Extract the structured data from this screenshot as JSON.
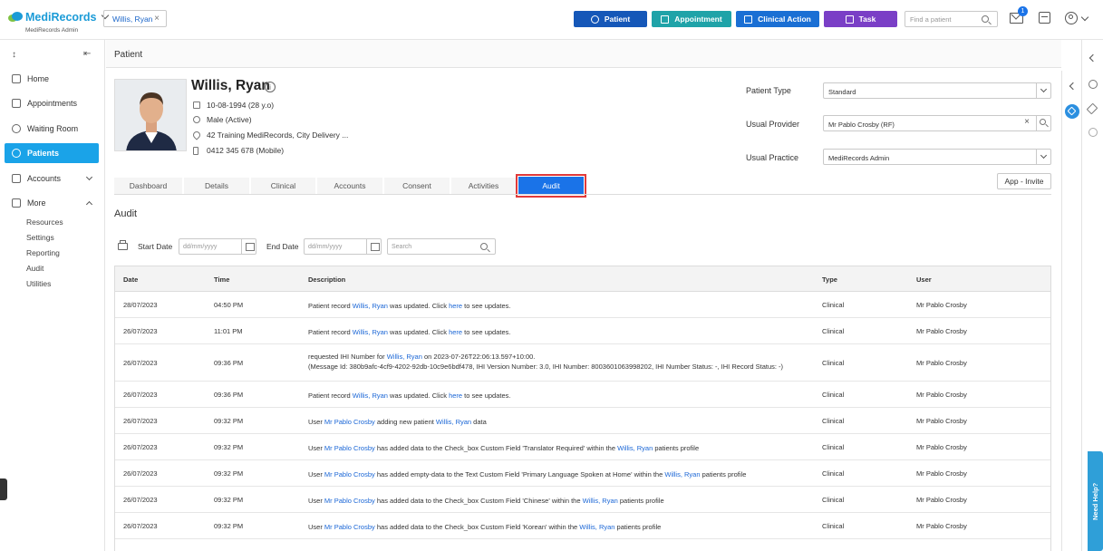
{
  "header": {
    "brand": "MediRecords",
    "brand_sub": "MediRecords Admin",
    "patient_chip": "Willis, Ryan",
    "buttons": [
      {
        "label": "Patient",
        "color": "#1557b8"
      },
      {
        "label": "Appointment",
        "color": "#1fa3a8"
      },
      {
        "label": "Clinical Action",
        "color": "#1a6fd4"
      },
      {
        "label": "Task",
        "color": "#7a3fc6"
      }
    ],
    "find_placeholder": "Find a patient",
    "notification_count": "1"
  },
  "sidebar": {
    "items": [
      {
        "label": "Home"
      },
      {
        "label": "Appointments"
      },
      {
        "label": "Waiting Room"
      },
      {
        "label": "Patients"
      },
      {
        "label": "Accounts"
      },
      {
        "label": "More"
      }
    ],
    "sub_items": [
      "Resources",
      "Settings",
      "Reporting",
      "Audit",
      "Utilities"
    ]
  },
  "page": {
    "title": "Patient",
    "patient": {
      "name": "Willis, Ryan",
      "dob": "10-08-1994 (28 y.o)",
      "gender": "Male (Active)",
      "address": "42 Training MediRecords, City Delivery ...",
      "phone": "0412 345 678 (Mobile)"
    },
    "fields": {
      "patient_type_label": "Patient Type",
      "patient_type_value": "Standard",
      "provider_label": "Usual Provider",
      "provider_value": "Mr Pablo Crosby (RF)",
      "practice_label": "Usual Practice",
      "practice_value": "MediRecords Admin"
    },
    "app_invite": "App - Invite",
    "tabs": [
      "Dashboard",
      "Details",
      "Clinical",
      "Accounts",
      "Consent",
      "Activities",
      "Audit"
    ]
  },
  "audit": {
    "title": "Audit",
    "start_label": "Start Date",
    "end_label": "End Date",
    "date_placeholder": "dd/mm/yyyy",
    "search_placeholder": "Search",
    "columns": [
      "Date",
      "Time",
      "Description",
      "Type",
      "User"
    ],
    "rows": [
      {
        "date": "28/07/2023",
        "time": "04:50 PM",
        "pre": "Patient record ",
        "link1": "Willis, Ryan",
        "mid": " was updated. Click ",
        "link2": "here",
        "post": " to see updates.",
        "type": "Clinical",
        "user": "Mr Pablo Crosby"
      },
      {
        "date": "26/07/2023",
        "time": "11:01 PM",
        "pre": "Patient record ",
        "link1": "Willis, Ryan",
        "mid": " was updated. Click ",
        "link2": "here",
        "post": " to see updates.",
        "type": "Clinical",
        "user": "Mr Pablo Crosby"
      },
      {
        "date": "26/07/2023",
        "time": "09:36 PM",
        "pre": "requested IHI Number for ",
        "link1": "Willis, Ryan",
        "mid": " on 2023-07-26T22:06:13.597+10:00.",
        "line2": "(Message Id: 380b9afc-4cf9-4202-92db-10c9e6bdf478, IHI Version Number: 3.0, IHI Number: 8003601063998202, IHI Number Status: -, IHI Record Status: -)",
        "type": "Clinical",
        "user": "Mr Pablo Crosby"
      },
      {
        "date": "26/07/2023",
        "time": "09:36 PM",
        "pre": "Patient record ",
        "link1": "Willis, Ryan",
        "mid": " was updated. Click ",
        "link2": "here",
        "post": " to see updates.",
        "type": "Clinical",
        "user": "Mr Pablo Crosby"
      },
      {
        "date": "26/07/2023",
        "time": "09:32 PM",
        "pre": "User ",
        "link1": "Mr Pablo Crosby",
        "mid": " adding new patient ",
        "link2": "Willis, Ryan",
        "post": " data",
        "type": "Clinical",
        "user": "Mr Pablo Crosby"
      },
      {
        "date": "26/07/2023",
        "time": "09:32 PM",
        "pre": "User ",
        "link1": "Mr Pablo Crosby",
        "mid": " has added data to the Check_box Custom Field 'Translator Required' within the ",
        "link2": "Willis, Ryan",
        "post": " patients profile",
        "type": "Clinical",
        "user": "Mr Pablo Crosby"
      },
      {
        "date": "26/07/2023",
        "time": "09:32 PM",
        "pre": "User ",
        "link1": "Mr Pablo Crosby",
        "mid": " has added empty-data to the Text Custom Field 'Primary Language Spoken at Home' within the ",
        "link2": "Willis, Ryan",
        "post": " patients profile",
        "type": "Clinical",
        "user": "Mr Pablo Crosby"
      },
      {
        "date": "26/07/2023",
        "time": "09:32 PM",
        "pre": "User ",
        "link1": "Mr Pablo Crosby",
        "mid": " has added data to the Check_box Custom Field 'Chinese' within the ",
        "link2": "Willis, Ryan",
        "post": " patients profile",
        "type": "Clinical",
        "user": "Mr Pablo Crosby"
      },
      {
        "date": "26/07/2023",
        "time": "09:32 PM",
        "pre": "User ",
        "link1": "Mr Pablo Crosby",
        "mid": " has added data to the Check_box Custom Field 'Korean' within the ",
        "link2": "Willis, Ryan",
        "post": " patients profile",
        "type": "Clinical",
        "user": "Mr Pablo Crosby"
      }
    ]
  },
  "help": {
    "label": "Need Help?"
  }
}
